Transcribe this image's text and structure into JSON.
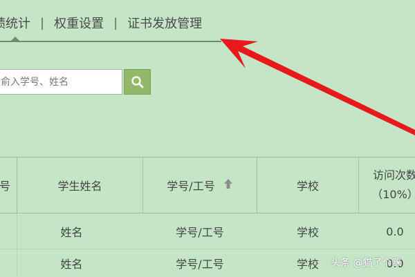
{
  "tabs": [
    {
      "label": "绩统计"
    },
    {
      "label": "权重设置"
    },
    {
      "label": "证书发放管理"
    }
  ],
  "tab_separator": "|",
  "search": {
    "placeholder": "俞入学号、姓名",
    "button_icon": "search-icon"
  },
  "table": {
    "headers": [
      "号",
      "学生姓名",
      "学号/工号",
      "学校",
      "访问次数",
      "（10%）"
    ],
    "sort_icon": "arrow-up-icon",
    "rows": [
      {
        "name": "姓名",
        "id": "学号/工号",
        "school": "学校",
        "visits": "0.0"
      },
      {
        "name": "姓名",
        "id": "学号/工号",
        "school": "学校",
        "visits": "0.0"
      }
    ]
  },
  "watermark": "头条 @猫了个咪",
  "colors": {
    "background": "#c4e6c6",
    "search_button": "#93b86a",
    "arrow": "#e8191c"
  }
}
